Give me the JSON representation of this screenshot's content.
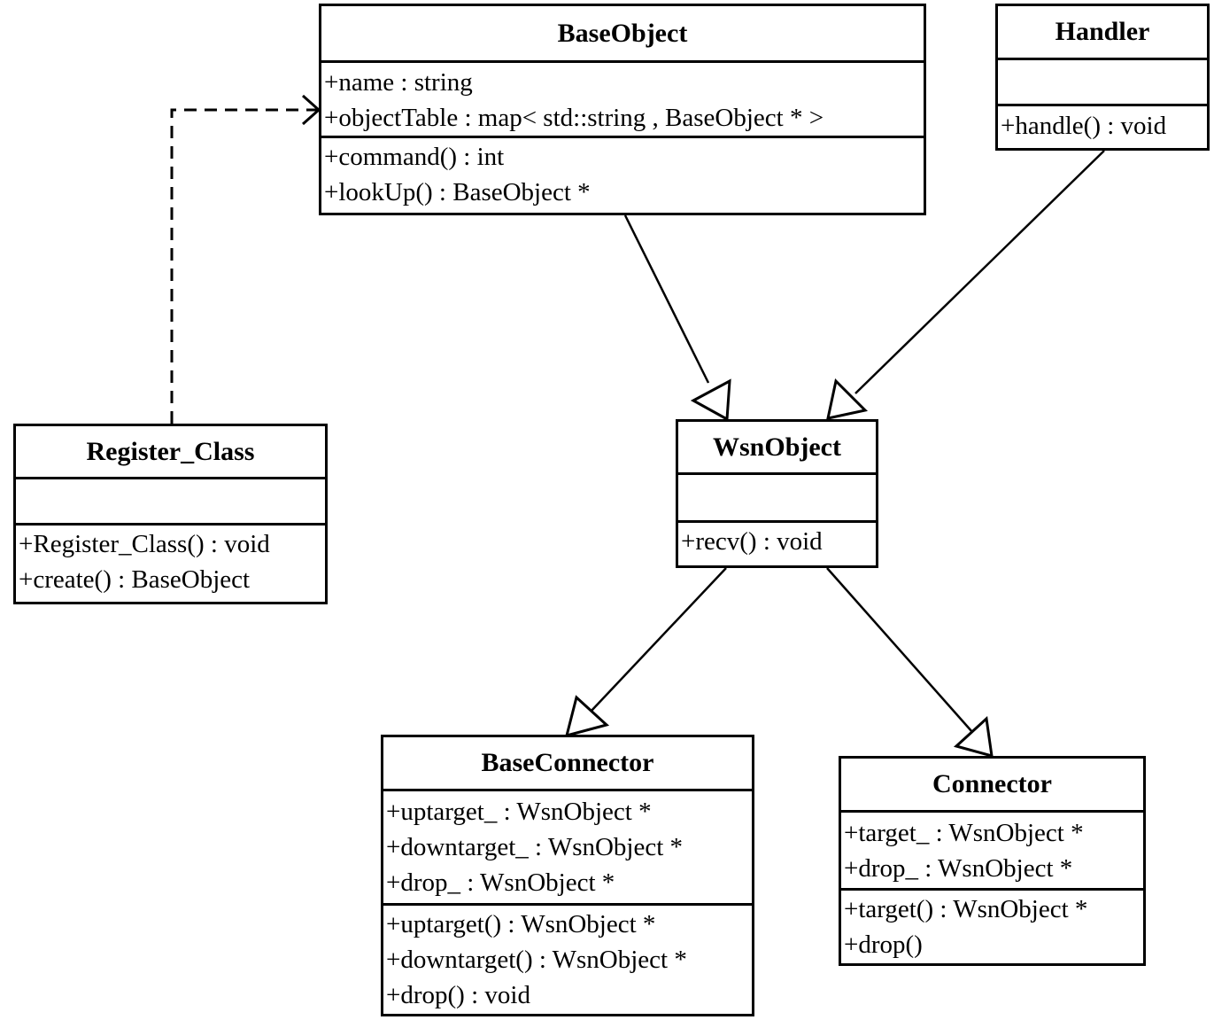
{
  "diagram": {
    "type": "UML class diagram",
    "classes": {
      "baseobject": {
        "name": "BaseObject",
        "attributes": [
          "+name : string",
          "+objectTable : map< std::string , BaseObject * >"
        ],
        "methods": [
          "+command() : int",
          "+lookUp() : BaseObject *"
        ]
      },
      "handler": {
        "name": "Handler",
        "attributes": [],
        "methods": [
          "+handle() : void"
        ]
      },
      "register_class": {
        "name": "Register_Class",
        "attributes": [],
        "methods": [
          "+Register_Class() : void",
          "+create() : BaseObject"
        ]
      },
      "wsnobject": {
        "name": "WsnObject",
        "attributes": [],
        "methods": [
          "+recv() : void"
        ]
      },
      "baseconnector": {
        "name": "BaseConnector",
        "attributes": [
          "+uptarget_ : WsnObject *",
          "+downtarget_ : WsnObject *",
          "+drop_ : WsnObject *"
        ],
        "methods": [
          "+uptarget() : WsnObject *",
          "+downtarget() : WsnObject *",
          "+drop() : void"
        ]
      },
      "connector": {
        "name": "Connector",
        "attributes": [
          "+target_ : WsnObject *",
          "+drop_ : WsnObject *"
        ],
        "methods": [
          "+target() : WsnObject *",
          "+drop()"
        ]
      }
    },
    "relationships": [
      {
        "type": "generalization",
        "from": "WsnObject",
        "to": "BaseObject"
      },
      {
        "type": "generalization",
        "from": "WsnObject",
        "to": "Handler"
      },
      {
        "type": "generalization",
        "from": "BaseConnector",
        "to": "WsnObject"
      },
      {
        "type": "generalization",
        "from": "Connector",
        "to": "WsnObject"
      },
      {
        "type": "dependency",
        "from": "Register_Class",
        "to": "BaseObject"
      }
    ]
  }
}
